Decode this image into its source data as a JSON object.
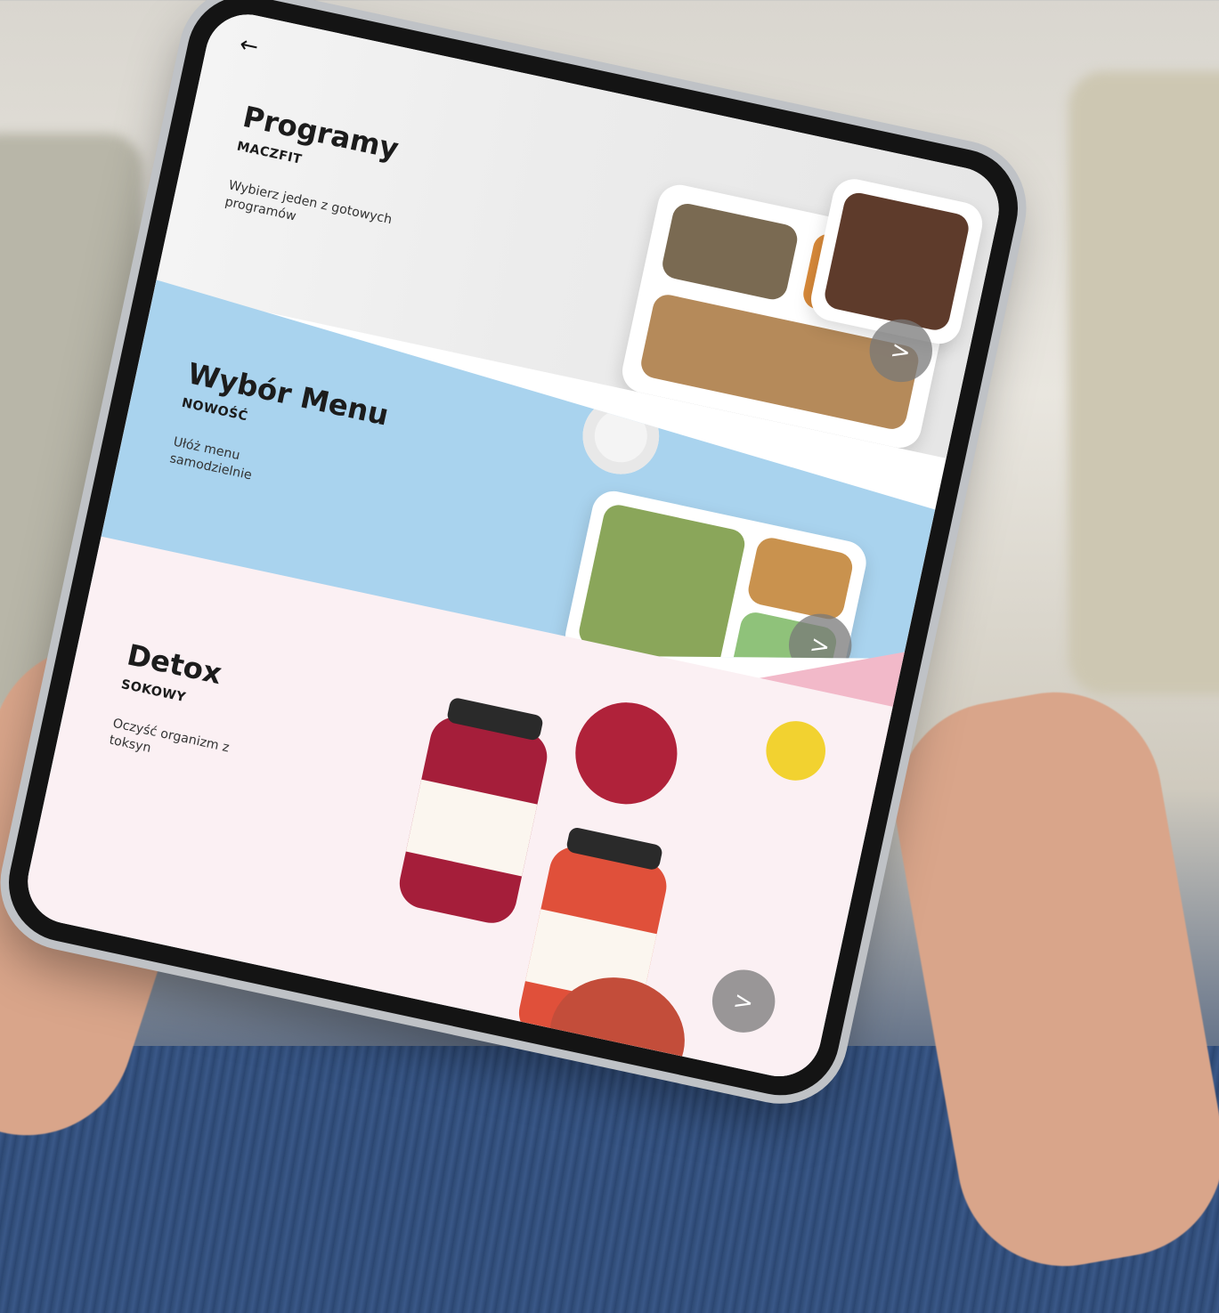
{
  "screen": {
    "back_icon": "arrow-left-icon",
    "back_glyph": "←",
    "next_glyph": ">",
    "colors": {
      "programy_bg": "#ececec",
      "menu_bg": "#a9d3ee",
      "detox_bg": "#fbf0f3",
      "pink_accent": "#f2b9c9",
      "next_button": "#787878"
    },
    "sections": [
      {
        "title": "Programy",
        "subtitle": "MACZFIT",
        "description": "Wybierz jeden z gotowych programów"
      },
      {
        "title": "Wybór Menu",
        "subtitle": "NOWOŚĆ",
        "description": "Ułóż menu samodzielnie"
      },
      {
        "title": "Detox",
        "subtitle": "SOKOWY",
        "description": "Oczyść organizm z toksyn"
      }
    ]
  }
}
